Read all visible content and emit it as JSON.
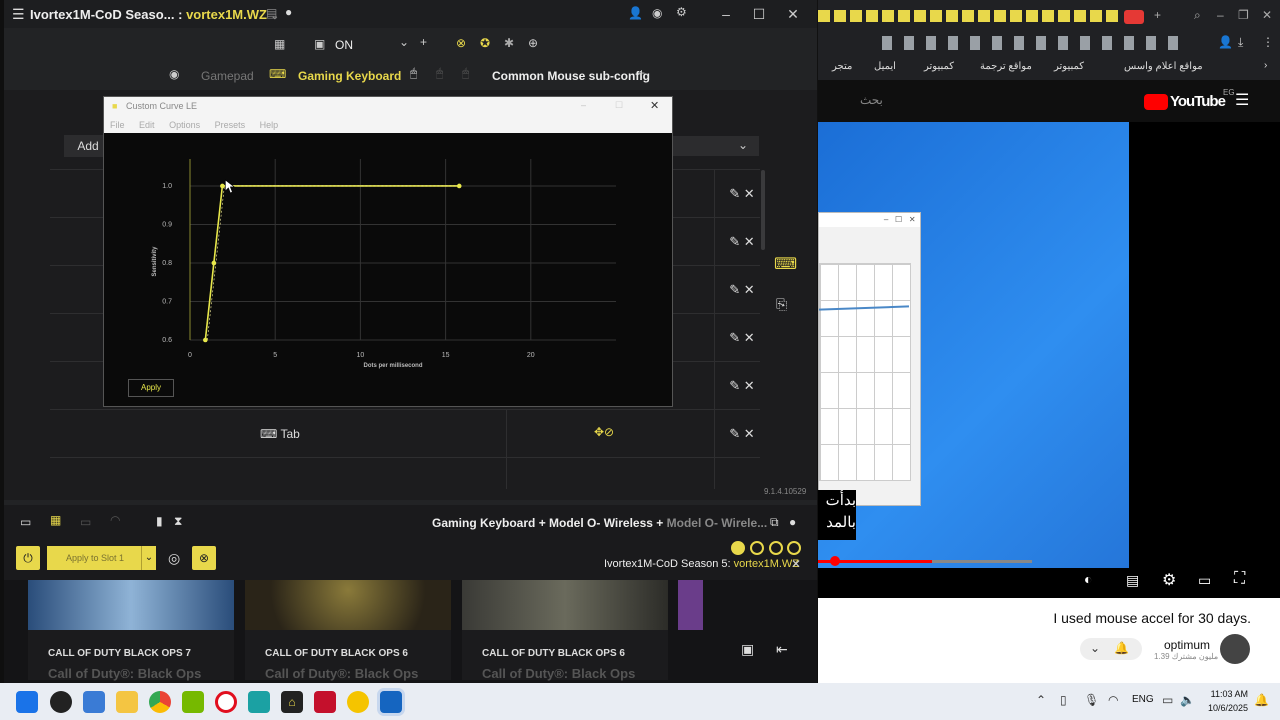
{
  "rewasd": {
    "title": "Ivortex1M-CoD Seaso... :",
    "title_accent": "vortex1M.WZ",
    "toolbar": {
      "toggle_label": "ON",
      "tabs": [
        "Gamepad",
        "Gaming Keyboard",
        "Common Mouse sub-config"
      ],
      "add_button": "Add"
    },
    "rows": [
      {
        "key": "Tab"
      }
    ],
    "version": "9.1.4.10529",
    "footer": {
      "devices_text": "Gaming Keyboard + Model O- Wireless + ",
      "devices_faded": "Model O- Wirele...",
      "apply_slot": "Apply to Slot 1",
      "config_name": "Ivortex1M-CoD Season 5:",
      "config_accent": "vortex1M.WZ"
    },
    "accent": "#e8d84b"
  },
  "curve_dialog": {
    "title": "Custom Curve LE",
    "menu": [
      "File",
      "Edit",
      "Options",
      "Presets",
      "Help"
    ],
    "apply": "Apply"
  },
  "chart_data": {
    "type": "line",
    "xlabel": "Dots per millisecond",
    "ylabel": "Sensitivity",
    "xlim": [
      0,
      25
    ],
    "ylim": [
      0.6,
      1.07
    ],
    "x_ticks": [
      "0",
      "5",
      "10",
      "15",
      "20"
    ],
    "y_ticks": [
      "0.6",
      "0.7",
      "0.8",
      "0.9",
      "1.0"
    ],
    "series": [
      {
        "x": [
          0.9,
          1.4,
          1.9,
          15.8
        ],
        "y": [
          0.6,
          0.8,
          1.0,
          1.0
        ],
        "color": "#e8e84b"
      }
    ],
    "grid": true
  },
  "games": [
    {
      "label": "CALL OF DUTY BLACK OPS 7",
      "title": "Call of Duty®: Black Ops"
    },
    {
      "label": "CALL OF DUTY BLACK OPS 6",
      "title": "Call of Duty®: Black Ops"
    },
    {
      "label": "CALL OF DUTY BLACK OPS 6",
      "title": "Call of Duty®: Black Ops"
    }
  ],
  "browser": {
    "bookmarks": [
      "متجر",
      "ايميل",
      "كمبيوتر",
      "مواقع ترجمة",
      "كمبيوتر",
      "مواقع اعلام واسس"
    ],
    "search_placeholder": "بحث",
    "yt_region": "EG",
    "subtitle": "بدأت بالمد",
    "video_title": "I used mouse accel for 30 days.",
    "channel": "optimum",
    "subs": "1.39 مليون مشترك"
  },
  "taskbar": {
    "lang": "ENG",
    "time": "11:03 AM",
    "date": "10/6/2025"
  }
}
